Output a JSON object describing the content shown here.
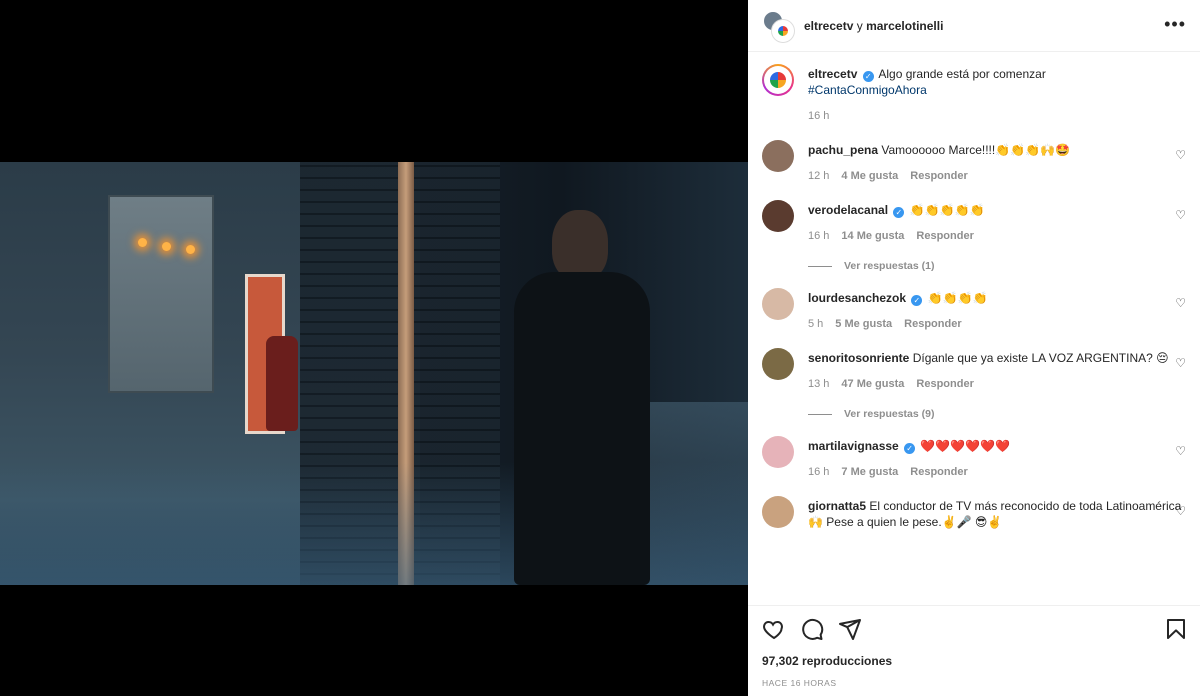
{
  "header": {
    "user1": "eltrecetv",
    "connector": "y",
    "user2": "marcelotinelli",
    "more": "•••"
  },
  "caption": {
    "username": "eltrecetv",
    "text": "Algo grande está por comenzar",
    "hashtag": "#CantaConmigoAhora",
    "time": "16 h",
    "verified": true
  },
  "comments": [
    {
      "username": "pachu_pena",
      "verified": false,
      "text": "Vamoooooo Marce!!!!👏👏👏🙌🤩",
      "time": "12 h",
      "likes": "4 Me gusta",
      "reply": "Responder"
    },
    {
      "username": "verodelacanal",
      "verified": true,
      "text": "👏👏👏👏👏",
      "time": "16 h",
      "likes": "14 Me gusta",
      "reply": "Responder",
      "view_replies": "Ver respuestas (1)"
    },
    {
      "username": "lourdesanchezok",
      "verified": true,
      "text": "👏👏👏👏",
      "time": "5 h",
      "likes": "5 Me gusta",
      "reply": "Responder"
    },
    {
      "username": "senoritosonriente",
      "verified": false,
      "text": "Díganle que ya existe LA VOZ ARGENTINA? 😔",
      "time": "13 h",
      "likes": "47 Me gusta",
      "reply": "Responder",
      "view_replies": "Ver respuestas (9)"
    },
    {
      "username": "martilavignasse",
      "verified": true,
      "text": "❤️❤️❤️❤️❤️❤️",
      "time": "16 h",
      "likes": "7 Me gusta",
      "reply": "Responder"
    },
    {
      "username": "giornatta5",
      "verified": false,
      "text": "El conductor de TV más reconocido de toda Latinoamérica 🙌 Pese a quien le pese.✌️🎤 😎✌️"
    }
  ],
  "footer": {
    "views": "97,302 reproducciones",
    "ago": "HACE 16 HORAS"
  },
  "icons": {
    "like": "heart-icon",
    "comment": "comment-icon",
    "share": "share-icon",
    "save": "bookmark-icon"
  }
}
